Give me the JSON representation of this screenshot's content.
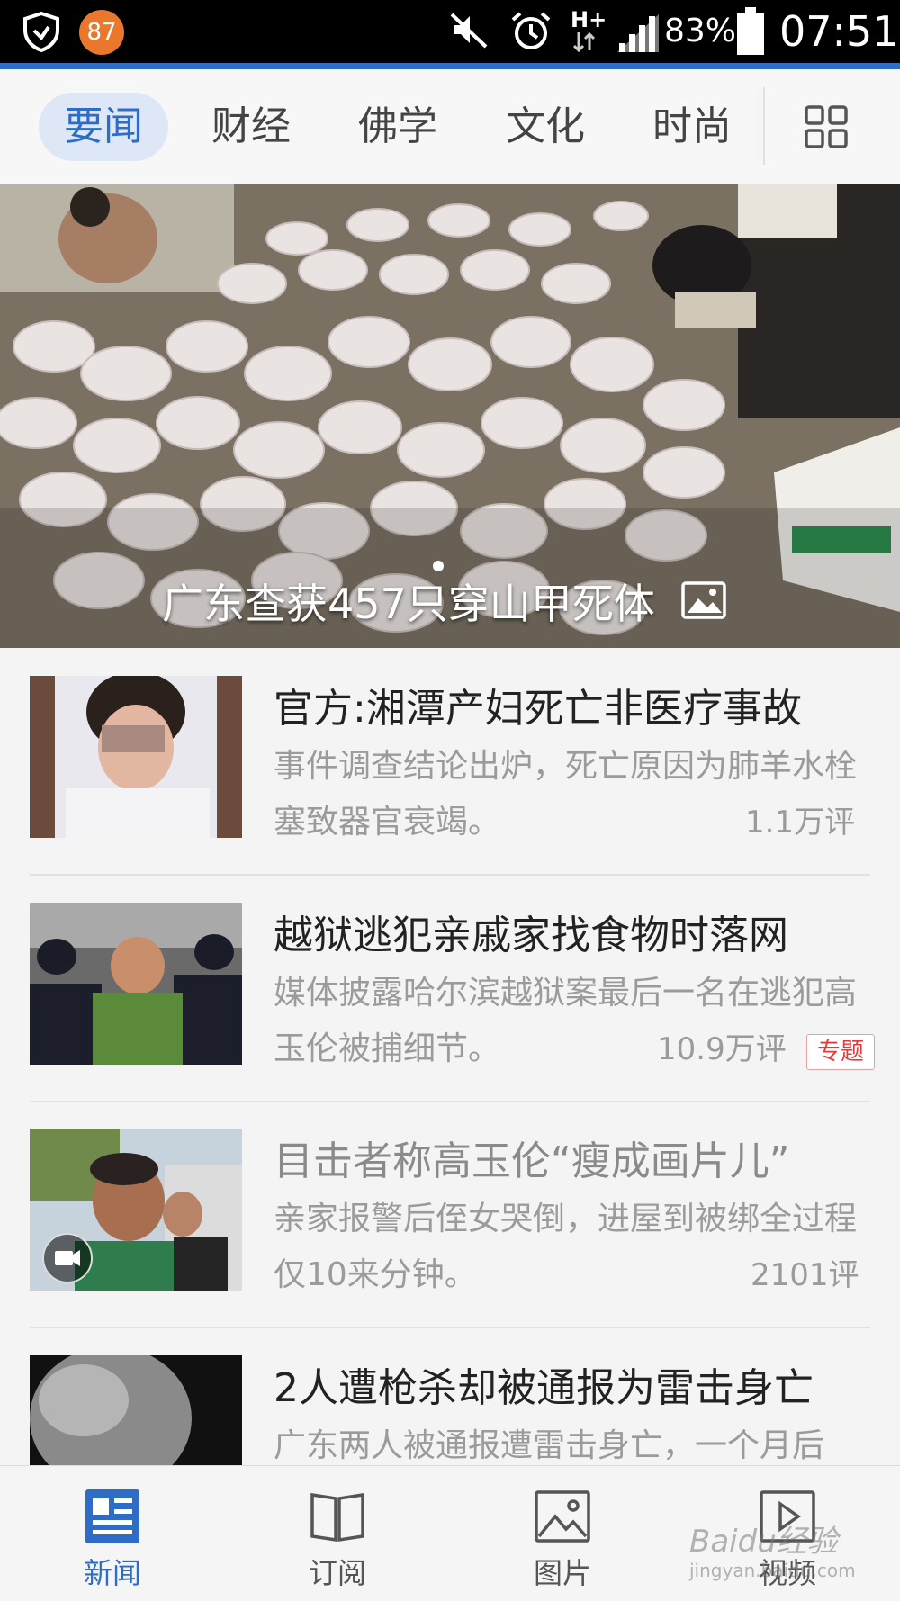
{
  "status_bar": {
    "notification_count": "87",
    "network": "H+",
    "battery": "83%",
    "time": "07:51"
  },
  "tabs": [
    {
      "label": "要闻",
      "active": true
    },
    {
      "label": "财经",
      "active": false
    },
    {
      "label": "佛学",
      "active": false
    },
    {
      "label": "文化",
      "active": false
    },
    {
      "label": "时尚",
      "active": false
    }
  ],
  "hero": {
    "caption": "广东查获457只穿山甲死体"
  },
  "news": [
    {
      "title": "官方:湘潭产妇死亡非医疗事故",
      "summary": "事件调查结论出炉，死亡原因为肺羊水栓塞致器官衰竭。",
      "comments": "1.1万评"
    },
    {
      "title": "越狱逃犯亲戚家找食物时落网",
      "summary": "媒体披露哈尔滨越狱案最后一名在逃犯高玉伦被捕细节。",
      "comments": "10.9万评",
      "tag": "专题"
    },
    {
      "title": "目击者称高玉伦“瘦成画片儿”",
      "summary": "亲家报警后侄女哭倒，进屋到被绑全过程仅10来分钟。",
      "comments": "2101评",
      "read": true,
      "has_video": true
    },
    {
      "title": "2人遭枪杀却被通报为雷击身亡",
      "summary": "广东两人被通报遭雷击身亡，一个月后"
    }
  ],
  "bottom_nav": [
    {
      "label": "新闻",
      "icon": "news-icon",
      "active": true
    },
    {
      "label": "订阅",
      "icon": "book-icon",
      "active": false
    },
    {
      "label": "图片",
      "icon": "picture-icon",
      "active": false
    },
    {
      "label": "视频",
      "icon": "video-icon",
      "active": false
    }
  ],
  "watermark": {
    "text": "Baidu经验",
    "url": "jingyan.baidu.com"
  },
  "colors": {
    "accent": "#2f6cc6",
    "badge": "#e9782c",
    "tag_red": "#e43a3a"
  }
}
